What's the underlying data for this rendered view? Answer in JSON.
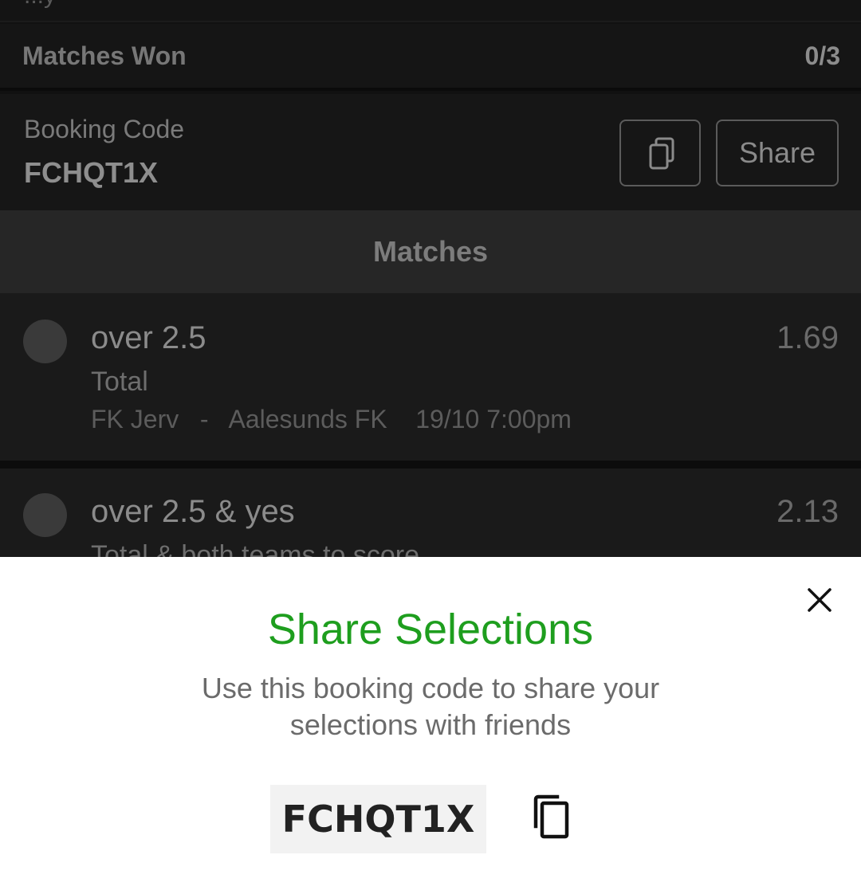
{
  "top": {
    "cut_text": "...y"
  },
  "summary": {
    "matches_won_label": "Matches Won",
    "matches_won_value": "0/3"
  },
  "booking": {
    "label": "Booking Code",
    "code": "FCHQT1X",
    "copy_icon": "copy-icon",
    "share_label": "Share"
  },
  "matches": {
    "header": "Matches",
    "items": [
      {
        "pick": "over 2.5",
        "market": "Total",
        "teams": "FK Jerv   -   Aalesunds FK    19/10 7:00pm",
        "odds": "1.69"
      },
      {
        "pick": "over 2.5 & yes",
        "market": "Total & both teams to score",
        "odds": "2.13"
      }
    ]
  },
  "share_sheet": {
    "title": "Share Selections",
    "subtitle": "Use this booking code to share your selections with friends",
    "code": "FCHQT1X",
    "close_icon": "close-icon",
    "copy_icon": "copy-icon"
  },
  "colors": {
    "title_green": "#1e9e1e",
    "backdrop": "#111111",
    "sheet_bg": "#ffffff"
  }
}
